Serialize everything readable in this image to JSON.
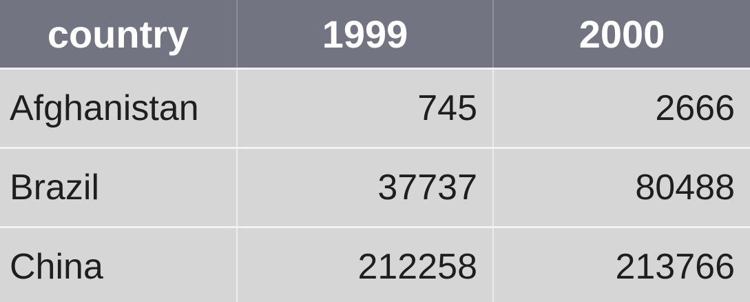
{
  "chart_data": {
    "type": "table",
    "columns": [
      "country",
      "1999",
      "2000"
    ],
    "rows": [
      {
        "country": "Afghanistan",
        "1999": "745",
        "2000": "2666"
      },
      {
        "country": "Brazil",
        "1999": "37737",
        "2000": "80488"
      },
      {
        "country": "China",
        "1999": "212258",
        "2000": "213766"
      }
    ]
  },
  "colors": {
    "header_bg": "#727581",
    "header_text": "#ffffff",
    "cell_bg": "#d6d6d7",
    "cell_text": "#1e1e1e"
  }
}
